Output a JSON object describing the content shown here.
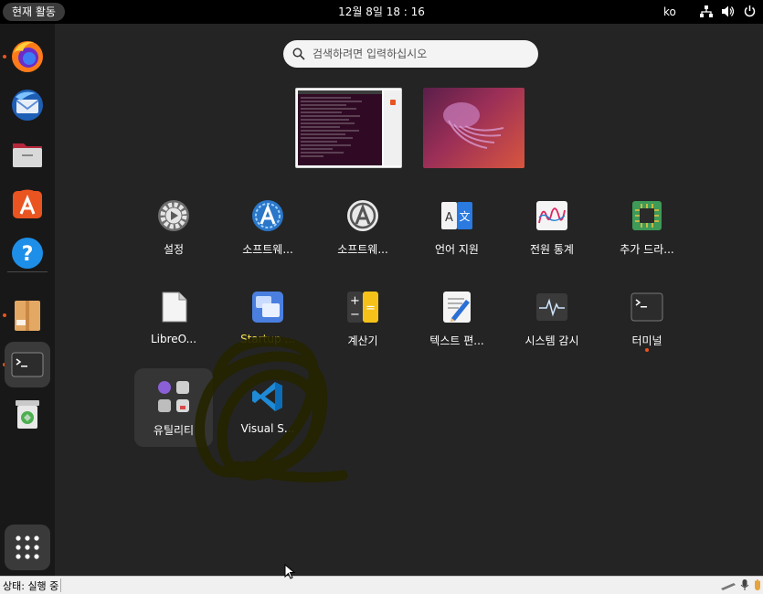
{
  "topbar": {
    "activities": "현재 활동",
    "clock": "12월 8일  18 : 16",
    "lang": "ko",
    "icons": [
      "network-icon",
      "volume-icon",
      "power-icon"
    ]
  },
  "dock": {
    "items": [
      "firefox",
      "thunderbird",
      "files",
      "app-center",
      "help",
      "archive",
      "terminal",
      "trash"
    ],
    "show_apps": "show-apps-grid"
  },
  "search": {
    "placeholder": "검색하려면 입력하십시오"
  },
  "apps": [
    {
      "label": "설정"
    },
    {
      "label": "소프트웨..."
    },
    {
      "label": "소프트웨..."
    },
    {
      "label": "언어 지원"
    },
    {
      "label": "전원 통계"
    },
    {
      "label": "추가 드라..."
    },
    {
      "label": "LibreO..."
    },
    {
      "label": "Startup ..."
    },
    {
      "label": "계산기"
    },
    {
      "label": "텍스트 편..."
    },
    {
      "label": "시스템 감시"
    },
    {
      "label": "터미널"
    },
    {
      "label": "유틸리티"
    },
    {
      "label": "Visual S..."
    }
  ],
  "colors": {
    "accent": "#e95420",
    "highlight_label": "#f5e04a"
  },
  "statusbar": {
    "text": "상태: 실행 중"
  }
}
